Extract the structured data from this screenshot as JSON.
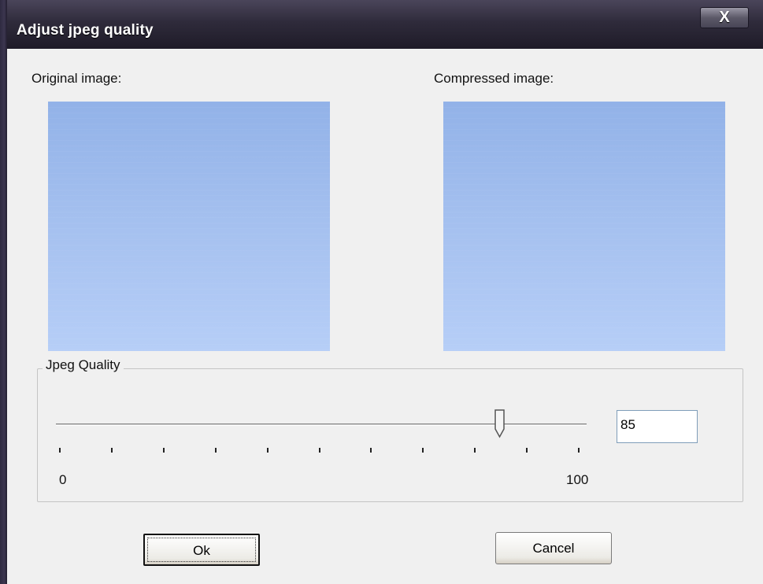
{
  "window": {
    "title": "Adjust jpeg quality",
    "close_label": "X"
  },
  "previews": {
    "original_label": "Original image:",
    "compressed_label": "Compressed image:"
  },
  "quality": {
    "group_label": "Jpeg Quality",
    "value": "85",
    "min_label": "0",
    "max_label": "100",
    "tick_count": 11
  },
  "buttons": {
    "ok_label": "Ok",
    "cancel_label": "Cancel"
  },
  "colors": {
    "preview_top": "#92b2e8",
    "preview_bottom": "#b6cef7",
    "title_bar": "#2f2b3b"
  }
}
